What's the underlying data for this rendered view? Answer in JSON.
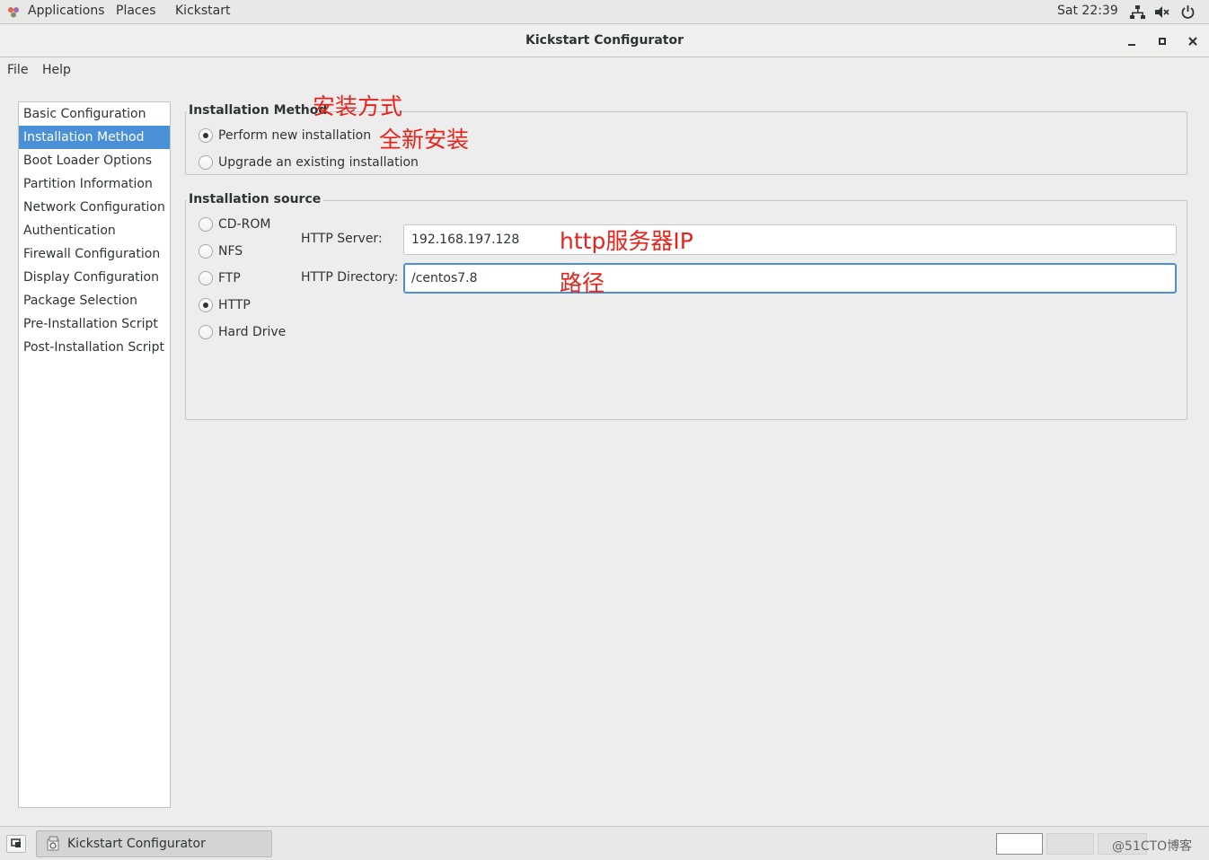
{
  "topbar": {
    "applications": "Applications",
    "places": "Places",
    "kickstart": "Kickstart",
    "clock": "Sat 22:39",
    "icons": [
      "network-icon",
      "volume-muted-icon",
      "power-icon"
    ]
  },
  "window": {
    "title": "Kickstart Configurator"
  },
  "menubar": {
    "file": "File",
    "help": "Help"
  },
  "sidebar": {
    "items": [
      {
        "label": "Basic Configuration"
      },
      {
        "label": "Installation Method"
      },
      {
        "label": "Boot Loader Options"
      },
      {
        "label": "Partition Information"
      },
      {
        "label": "Network Configuration"
      },
      {
        "label": "Authentication"
      },
      {
        "label": "Firewall Configuration"
      },
      {
        "label": "Display Configuration"
      },
      {
        "label": "Package Selection"
      },
      {
        "label": "Pre-Installation Script"
      },
      {
        "label": "Post-Installation Script"
      }
    ],
    "selected": "Installation Method"
  },
  "install_method": {
    "title": "Installation Method",
    "options": [
      {
        "label": "Perform new installation",
        "checked": true
      },
      {
        "label": "Upgrade an existing installation",
        "checked": false
      }
    ]
  },
  "install_source": {
    "title": "Installation source",
    "options": [
      {
        "label": "CD-ROM",
        "checked": false
      },
      {
        "label": "NFS",
        "checked": false
      },
      {
        "label": "FTP",
        "checked": false
      },
      {
        "label": "HTTP",
        "checked": true
      },
      {
        "label": "Hard Drive",
        "checked": false
      }
    ],
    "http_server_label": "HTTP Server:",
    "http_server_value": "192.168.197.128",
    "http_directory_label": "HTTP Directory:",
    "http_directory_value": "/centos7.8"
  },
  "annotations": {
    "install_method": "安装方式",
    "new_install": "全新安装",
    "http_server_ip": "http服务器IP",
    "path": "路径"
  },
  "taskbar": {
    "window_label": "Kickstart Configurator",
    "watermark": "@51CTO博客"
  },
  "colors": {
    "selection": "#4a90d9",
    "annotation": "#e8231c",
    "background": "#ededed"
  }
}
